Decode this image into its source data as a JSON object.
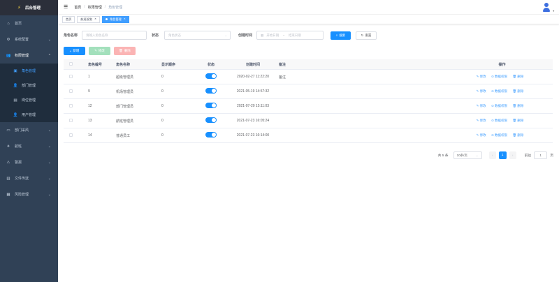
{
  "app": {
    "title": "后台管理"
  },
  "sidebar": {
    "items": [
      {
        "label": "首页",
        "icon": "home-icon"
      },
      {
        "label": "系统配置",
        "icon": "gear-icon"
      },
      {
        "label": "权限管理",
        "icon": "user-group-icon"
      },
      {
        "label": "部门采风",
        "icon": "folder-icon"
      },
      {
        "label": "航班",
        "icon": "plane-icon"
      },
      {
        "label": "警报",
        "icon": "alert-icon"
      },
      {
        "label": "文件传送",
        "icon": "file-icon"
      },
      {
        "label": "风险管理",
        "icon": "risk-icon"
      }
    ],
    "sub_items": [
      {
        "label": "角色管理",
        "icon": "role-icon"
      },
      {
        "label": "部门管理",
        "icon": "dept-icon"
      },
      {
        "label": "岗位管理",
        "icon": "post-icon"
      },
      {
        "label": "用户管理",
        "icon": "user-icon"
      }
    ]
  },
  "header": {
    "breadcrumb": [
      "首页",
      "权限管理",
      "角色管理"
    ]
  },
  "tags": [
    "首页",
    "航班规划",
    "角色管理"
  ],
  "search": {
    "role_name_label": "角色名称",
    "role_name_placeholder": "请输入角色名称",
    "status_label": "状态",
    "status_placeholder": "角色状态",
    "created_label": "创建时间",
    "start_placeholder": "开始日期",
    "range_sep": "-",
    "end_placeholder": "结束日期",
    "search_btn": "搜索",
    "reset_btn": "重置"
  },
  "toolbar": {
    "add": "新增",
    "edit": "修改",
    "delete": "删除"
  },
  "table": {
    "columns": [
      "角色编号",
      "角色名称",
      "显示顺序",
      "状态",
      "创建时间",
      "备注",
      "操作"
    ],
    "rows": [
      {
        "id": "1",
        "name": "超级管理员",
        "sort": "0",
        "enabled": true,
        "time": "2020-02-27 11:22:20",
        "remark": "备注"
      },
      {
        "id": "9",
        "name": "机场管理员",
        "sort": "0",
        "enabled": true,
        "time": "2021-05-19 14:57:32",
        "remark": ""
      },
      {
        "id": "12",
        "name": "部门管理员",
        "sort": "0",
        "enabled": true,
        "time": "2021-07-20 15:11:03",
        "remark": ""
      },
      {
        "id": "13",
        "name": "航班管理员",
        "sort": "0",
        "enabled": true,
        "time": "2021-07-23 16:05:24",
        "remark": ""
      },
      {
        "id": "14",
        "name": "普通员工",
        "sort": "0",
        "enabled": true,
        "time": "2021-07-23 16:14:00",
        "remark": ""
      }
    ],
    "ops": [
      "修改",
      "数据权限",
      "删除"
    ]
  },
  "pager": {
    "total": "共 5 条",
    "page_size": "10条/页",
    "current": "1",
    "goto_label": "前往",
    "goto_value": "1",
    "page_unit": "页"
  },
  "colors": {
    "sidebar": "#304156",
    "primary": "#1890ff"
  }
}
